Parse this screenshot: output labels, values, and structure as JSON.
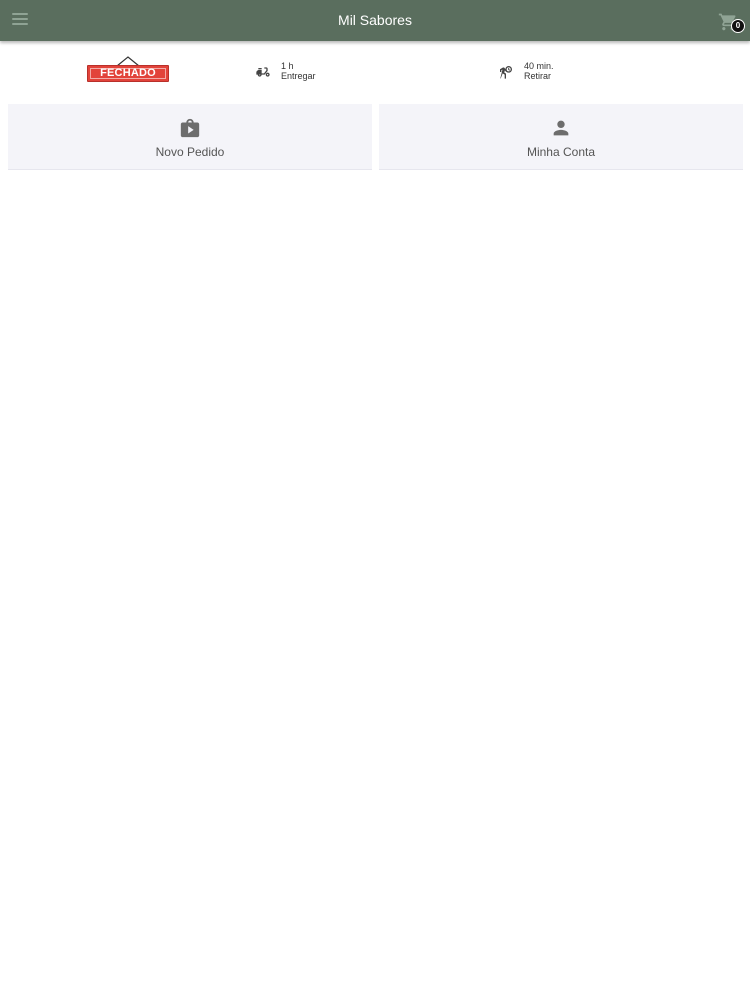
{
  "header": {
    "title": "Mil Sabores",
    "cart_count": "0"
  },
  "store_status": {
    "label": "FECHADO"
  },
  "delivery": {
    "time": "1 h",
    "label": "Entregar"
  },
  "pickup": {
    "time": "40 min.",
    "label": "Retirar"
  },
  "actions": [
    {
      "label": "Novo Pedido",
      "icon": "shopping-bag-play-icon"
    },
    {
      "label": "Minha Conta",
      "icon": "person-icon"
    }
  ],
  "colors": {
    "topbar": "#5a6e5e",
    "closed_sign": "#e2433a",
    "card_bg": "#f4f4f9",
    "icon_gray": "#6d6d6d"
  }
}
